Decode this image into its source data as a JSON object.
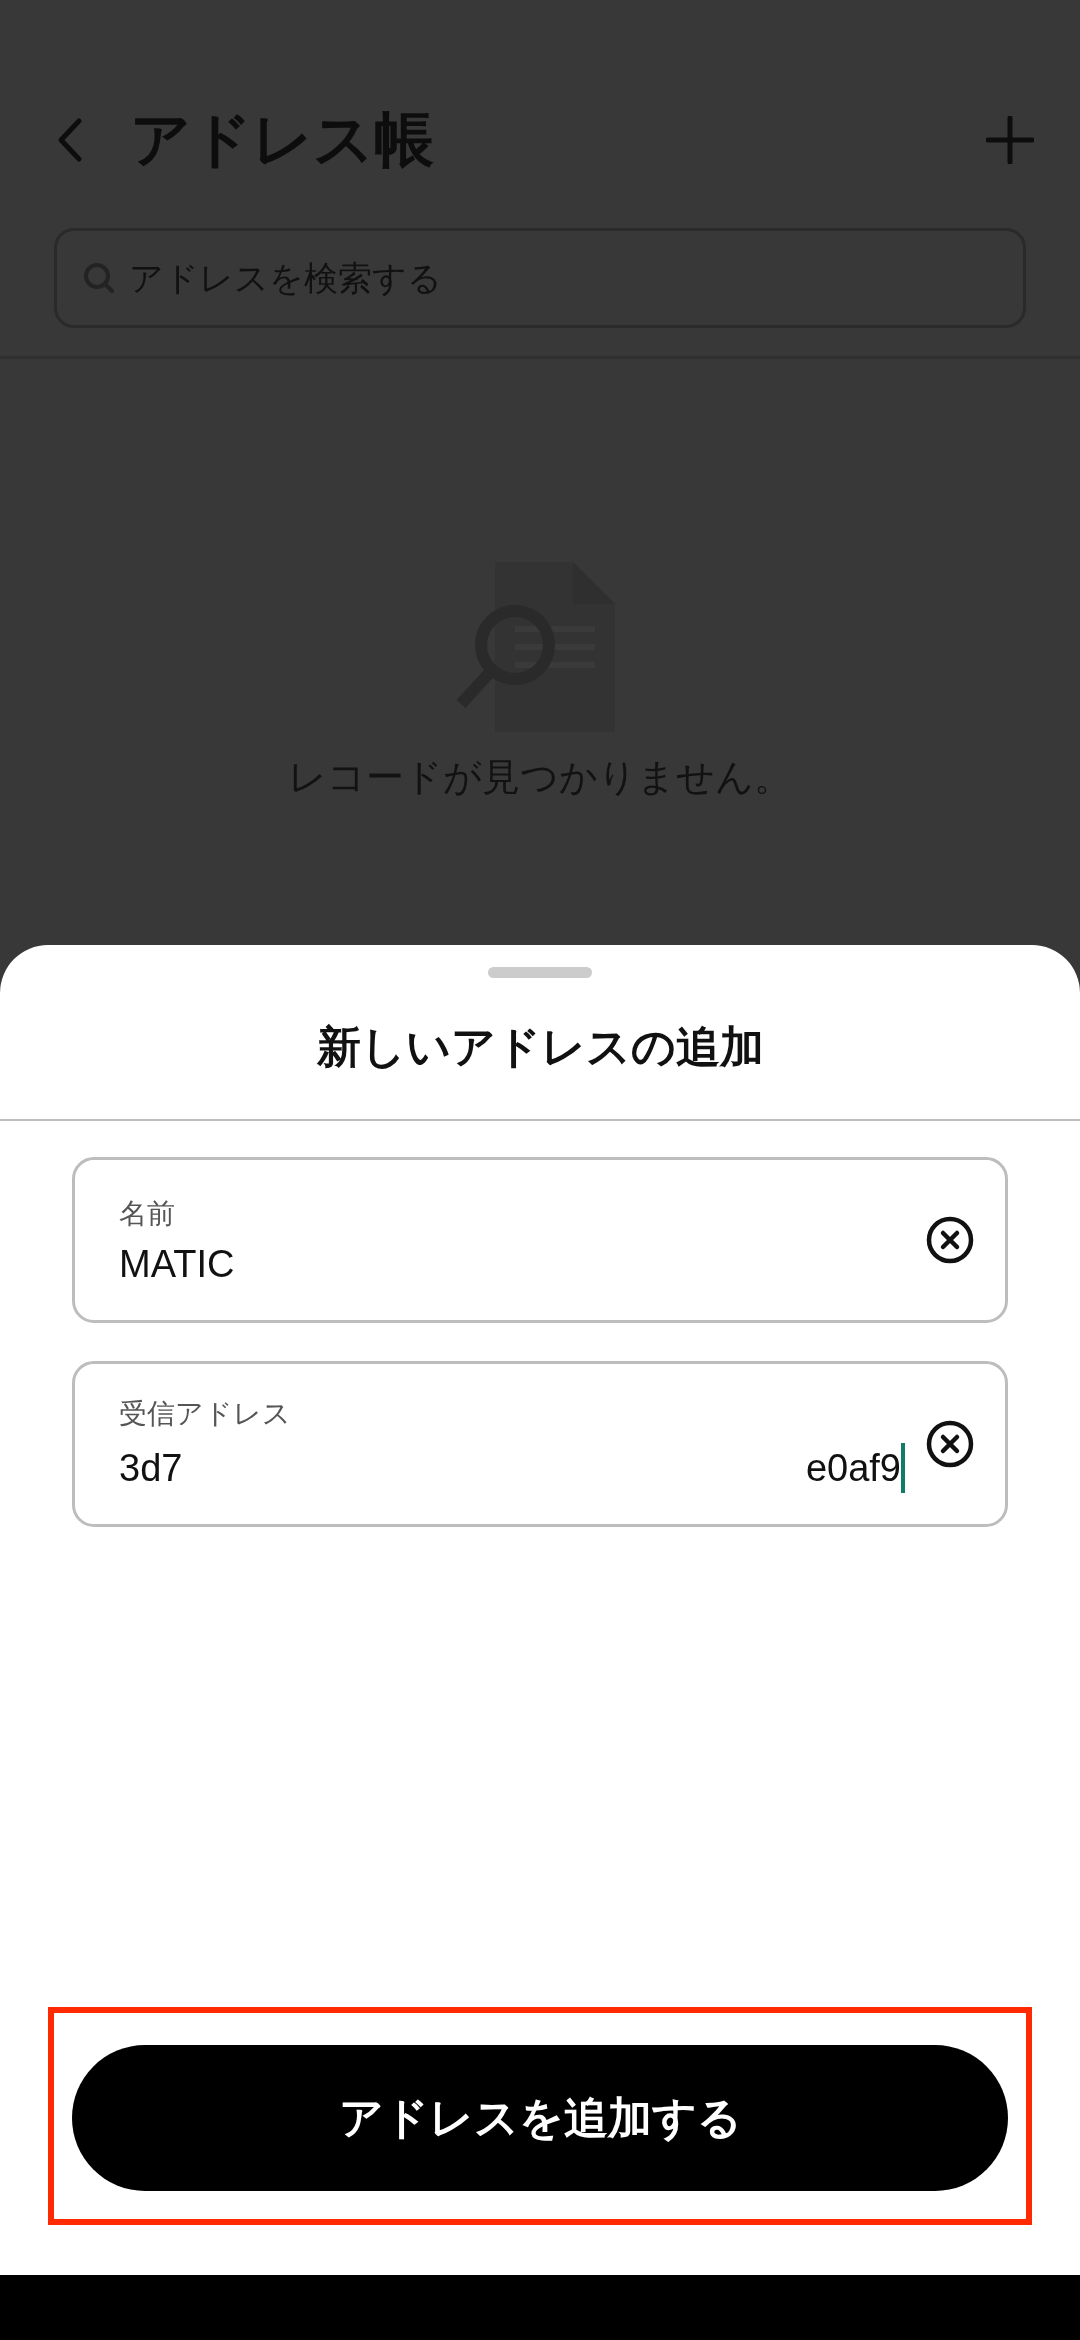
{
  "header": {
    "title": "アドレス帳"
  },
  "search": {
    "placeholder": "アドレスを検索する"
  },
  "empty_state": {
    "message": "レコードが見つかりません。"
  },
  "sheet": {
    "title": "新しいアドレスの追加",
    "fields": [
      {
        "label": "名前",
        "value_parts": [
          "MATIC"
        ],
        "focused": false
      },
      {
        "label": "受信アドレス",
        "value_parts": [
          "3d7",
          "e0af9"
        ],
        "focused": true
      }
    ],
    "submit": {
      "label": "アドレスを追加する",
      "highlighted": true
    }
  }
}
